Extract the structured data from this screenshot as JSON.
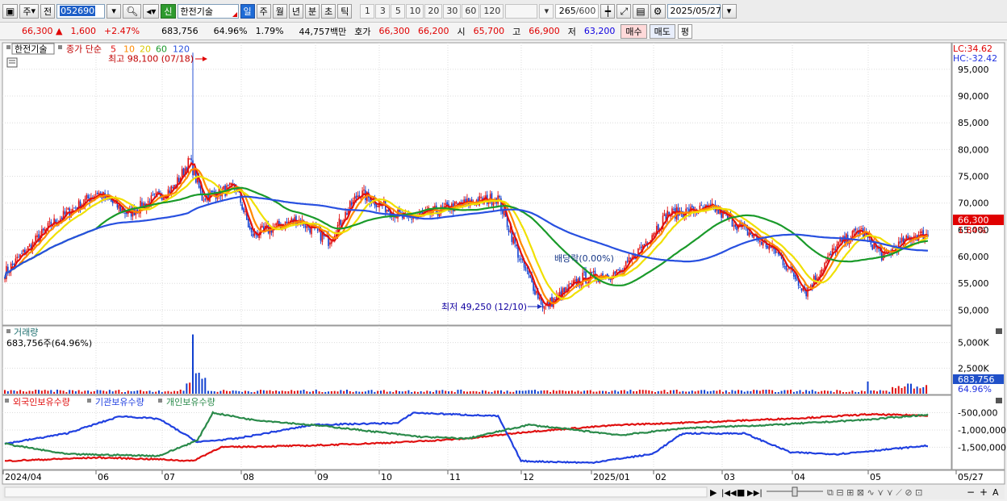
{
  "toolbar": {
    "period_label": "주",
    "prev_label": "전",
    "stock_code": "052690",
    "stock_badge": "신",
    "stock_name": "한전기술",
    "period_buttons": [
      "일",
      "주",
      "월",
      "년",
      "분",
      "초",
      "틱"
    ],
    "interval_buttons": [
      "1",
      "3",
      "5",
      "10",
      "20",
      "30",
      "60",
      "120"
    ],
    "count": "265",
    "count_max": "/600",
    "date": "2025/05/27"
  },
  "quote": {
    "price": "66,300",
    "change_arrow": "▲",
    "change": "1,600",
    "change_pct": "+2.47%",
    "volume": "683,756",
    "volume_ratio": "64.96%",
    "turnover_ratio": "1.79%",
    "trade_value": "44,757백만",
    "bid_label": "호가",
    "bid1": "66,300",
    "bid2": "66,200",
    "open_label": "시",
    "open": "65,700",
    "high_label": "고",
    "high": "66,900",
    "low_label": "저",
    "low": "63,200",
    "buy_label": "매수",
    "sell_label": "매도",
    "eval_label": "평"
  },
  "price_panel": {
    "title": "한전기술",
    "indicator_label": "종가 단순",
    "ma_periods": [
      "5",
      "10",
      "20",
      "60",
      "120"
    ],
    "ma_colors": [
      "#e01010",
      "#ff8a00",
      "#f0e000",
      "#1a9a2a",
      "#2850e0"
    ],
    "high_note": "최고 98,100 (07/18)",
    "low_note": "최저 49,250 (12/10)",
    "dividend_note": "배당락(0.00%)",
    "lc": "LC:34.62",
    "hc": "HC:-32.42",
    "current_price": "66,300",
    "current_pct": "1.84%"
  },
  "volume_panel": {
    "title": "거래량",
    "value_text": "683,756주(64.96%)",
    "current_value": "683,756",
    "current_pct": "64.96%"
  },
  "holding_panel": {
    "legend": [
      "외국인보유수량",
      "기관보유수량",
      "개인보유수량"
    ],
    "colors": [
      "#e01010",
      "#2040e0",
      "#2a8a4a"
    ]
  },
  "x_labels": [
    "2024/04",
    "06",
    "07",
    "08",
    "09",
    "10",
    "11",
    "12",
    "2025/01",
    "02",
    "03",
    "04",
    "05",
    "05/27"
  ],
  "chart_data": [
    {
      "type": "candlestick",
      "title": "한전기술",
      "y_ticks": [
        "95,000",
        "90,000",
        "85,000",
        "80,000",
        "75,000",
        "70,000",
        "65,000",
        "60,000",
        "55,000",
        "50,000"
      ],
      "ylim": [
        47500,
        99500
      ],
      "series_names": [
        "5",
        "10",
        "20",
        "60",
        "120"
      ],
      "annotations": [
        "최고 98,100 (07/18)",
        "최저 49,250 (12/10)",
        "배당락(0.00%)"
      ],
      "key_points": [
        [
          0,
          57000
        ],
        [
          30,
          66000
        ],
        [
          60,
          72000
        ],
        [
          80,
          68000
        ],
        [
          110,
          73000
        ],
        [
          120,
          78000
        ],
        [
          128,
          71000
        ],
        [
          150,
          73000
        ],
        [
          160,
          64000
        ],
        [
          190,
          67000
        ],
        [
          210,
          63000
        ],
        [
          230,
          72000
        ],
        [
          260,
          67000
        ],
        [
          300,
          70000
        ],
        [
          320,
          71000
        ],
        [
          335,
          59000
        ],
        [
          350,
          50500
        ],
        [
          375,
          56000
        ],
        [
          400,
          57000
        ],
        [
          430,
          68000
        ],
        [
          460,
          69000
        ],
        [
          480,
          65000
        ],
        [
          500,
          61000
        ],
        [
          520,
          53500
        ],
        [
          540,
          62000
        ],
        [
          555,
          65000
        ],
        [
          570,
          60000
        ],
        [
          590,
          64000
        ]
      ]
    },
    {
      "type": "bar",
      "title": "거래량",
      "y_ticks": [
        "5,000K",
        "2,500K"
      ],
      "ylim": [
        0,
        6000000
      ]
    },
    {
      "type": "line",
      "y_ticks": [
        "-500,000",
        "-1,000,000",
        "-1,500,000"
      ],
      "ylim": [
        -2100000,
        -300000
      ],
      "series": [
        {
          "name": "외국인보유수량",
          "points": [
            [
              0,
              -1900000
            ],
            [
              60,
              -1800000
            ],
            [
              100,
              -1850000
            ],
            [
              122,
              -1900000
            ],
            [
              140,
              -1500000
            ],
            [
              200,
              -1450000
            ],
            [
              260,
              -1350000
            ],
            [
              300,
              -1250000
            ],
            [
              340,
              -1050000
            ],
            [
              400,
              -850000
            ],
            [
              460,
              -760000
            ],
            [
              520,
              -650000
            ],
            [
              560,
              -550000
            ],
            [
              600,
              -580000
            ]
          ]
        },
        {
          "name": "기관보유수량",
          "points": [
            [
              0,
              -1400000
            ],
            [
              40,
              -1100000
            ],
            [
              75,
              -600000
            ],
            [
              100,
              -680000
            ],
            [
              125,
              -1350000
            ],
            [
              150,
              -1250000
            ],
            [
              200,
              -850000
            ],
            [
              255,
              -800000
            ],
            [
              265,
              -500000
            ],
            [
              320,
              -600000
            ],
            [
              335,
              -1900000
            ],
            [
              380,
              -1950000
            ],
            [
              420,
              -1700000
            ],
            [
              440,
              -1100000
            ],
            [
              480,
              -1100000
            ],
            [
              510,
              -1650000
            ],
            [
              540,
              -1700000
            ],
            [
              600,
              -1450000
            ]
          ]
        },
        {
          "name": "개인보유수량",
          "points": [
            [
              0,
              -1400000
            ],
            [
              40,
              -1700000
            ],
            [
              100,
              -1750000
            ],
            [
              125,
              -1300000
            ],
            [
              135,
              -500000
            ],
            [
              160,
              -700000
            ],
            [
              210,
              -900000
            ],
            [
              270,
              -1200000
            ],
            [
              300,
              -1250000
            ],
            [
              340,
              -850000
            ],
            [
              400,
              -1150000
            ],
            [
              440,
              -950000
            ],
            [
              500,
              -850000
            ],
            [
              560,
              -700000
            ],
            [
              600,
              -550000
            ]
          ]
        }
      ]
    }
  ]
}
